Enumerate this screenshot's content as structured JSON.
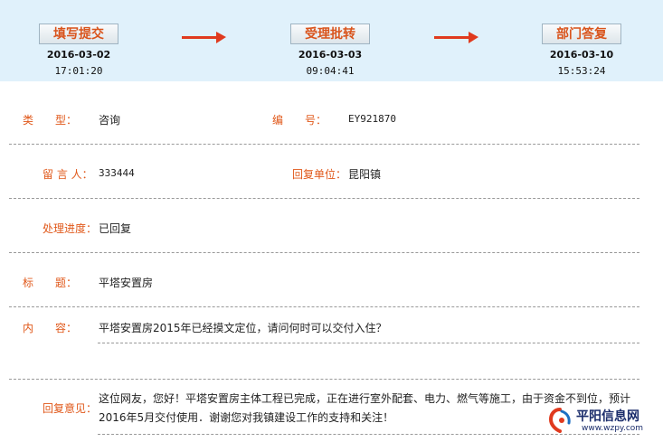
{
  "progress": {
    "steps": [
      {
        "label": "填写提交",
        "date": "2016-03-02",
        "time": "17:01:20"
      },
      {
        "label": "受理批转",
        "date": "2016-03-03",
        "time": "09:04:41"
      },
      {
        "label": "部门答复",
        "date": "2016-03-10",
        "time": "15:53:24"
      }
    ]
  },
  "fields": {
    "type_label": "类　　型：",
    "type_value": "咨询",
    "number_label": "编　　号：",
    "number_value": "EY921870",
    "author_label": "留 言 人：",
    "author_value": "333444",
    "reply_unit_label": "回复单位：",
    "reply_unit_value": "昆阳镇",
    "status_label": "处理进度：",
    "status_value": "已回复",
    "title_label": "标　　题：",
    "title_value": "平塔安置房",
    "content_label": "内　　容：",
    "content_value": "平塔安置房2015年已经摸文定位，请问何时可以交付入住？",
    "reply_label": "回复意见：",
    "reply_value": "这位网友，您好！平塔安置房主体工程已完成，正在进行室外配套、电力、燃气等施工，由于资金不到位，预计2016年5月交付使用．谢谢您对我镇建设工作的支持和关注！"
  },
  "watermark": {
    "site_name": "平阳信息网",
    "url": "www.wzpy.com"
  },
  "colors": {
    "label": "#e0581a",
    "banner_bg": "#e0f1fb",
    "arrow": "#e03a1e",
    "logo": "#1b2d6b"
  }
}
